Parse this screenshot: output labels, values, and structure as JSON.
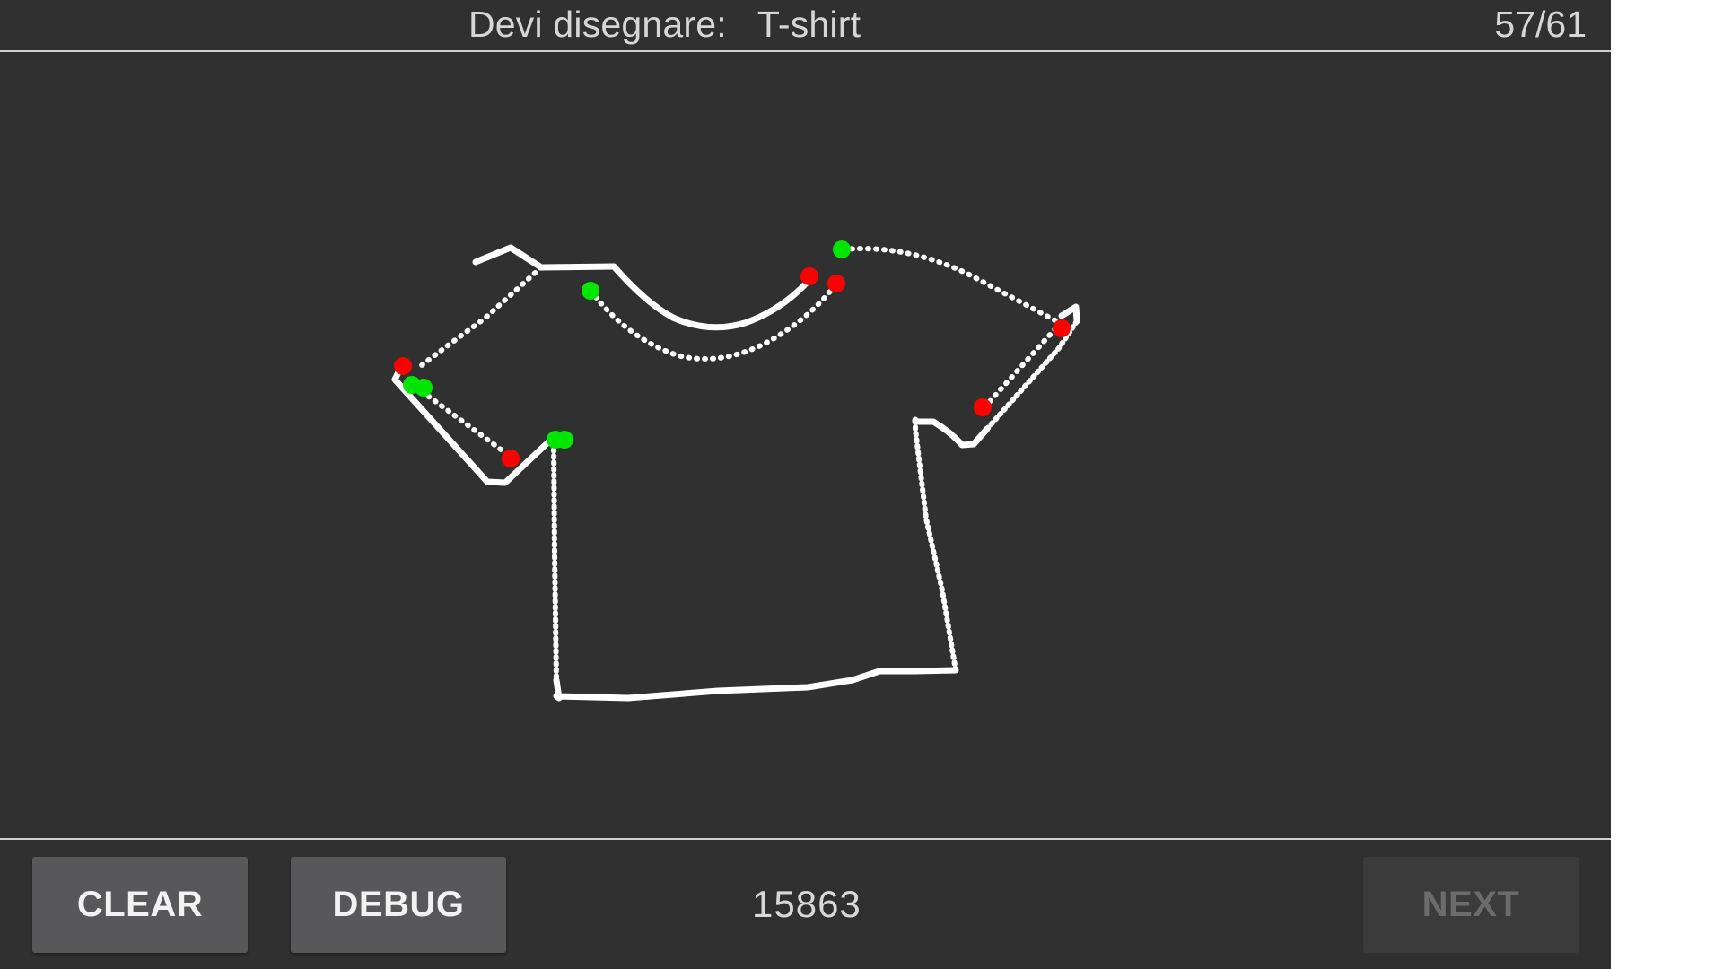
{
  "header": {
    "prompt_label": "Devi disegnare:",
    "target_word": "T-shirt",
    "progress": "57/61"
  },
  "footer": {
    "clear_label": "CLEAR",
    "debug_label": "DEBUG",
    "score": "15863",
    "next_label": "NEXT"
  },
  "canvas": {
    "background": "#303030",
    "stroke_color": "#ffffff",
    "stroke_start_color": "#00e600",
    "stroke_end_color": "#ff0000",
    "drawing_subject": "T-shirt"
  }
}
